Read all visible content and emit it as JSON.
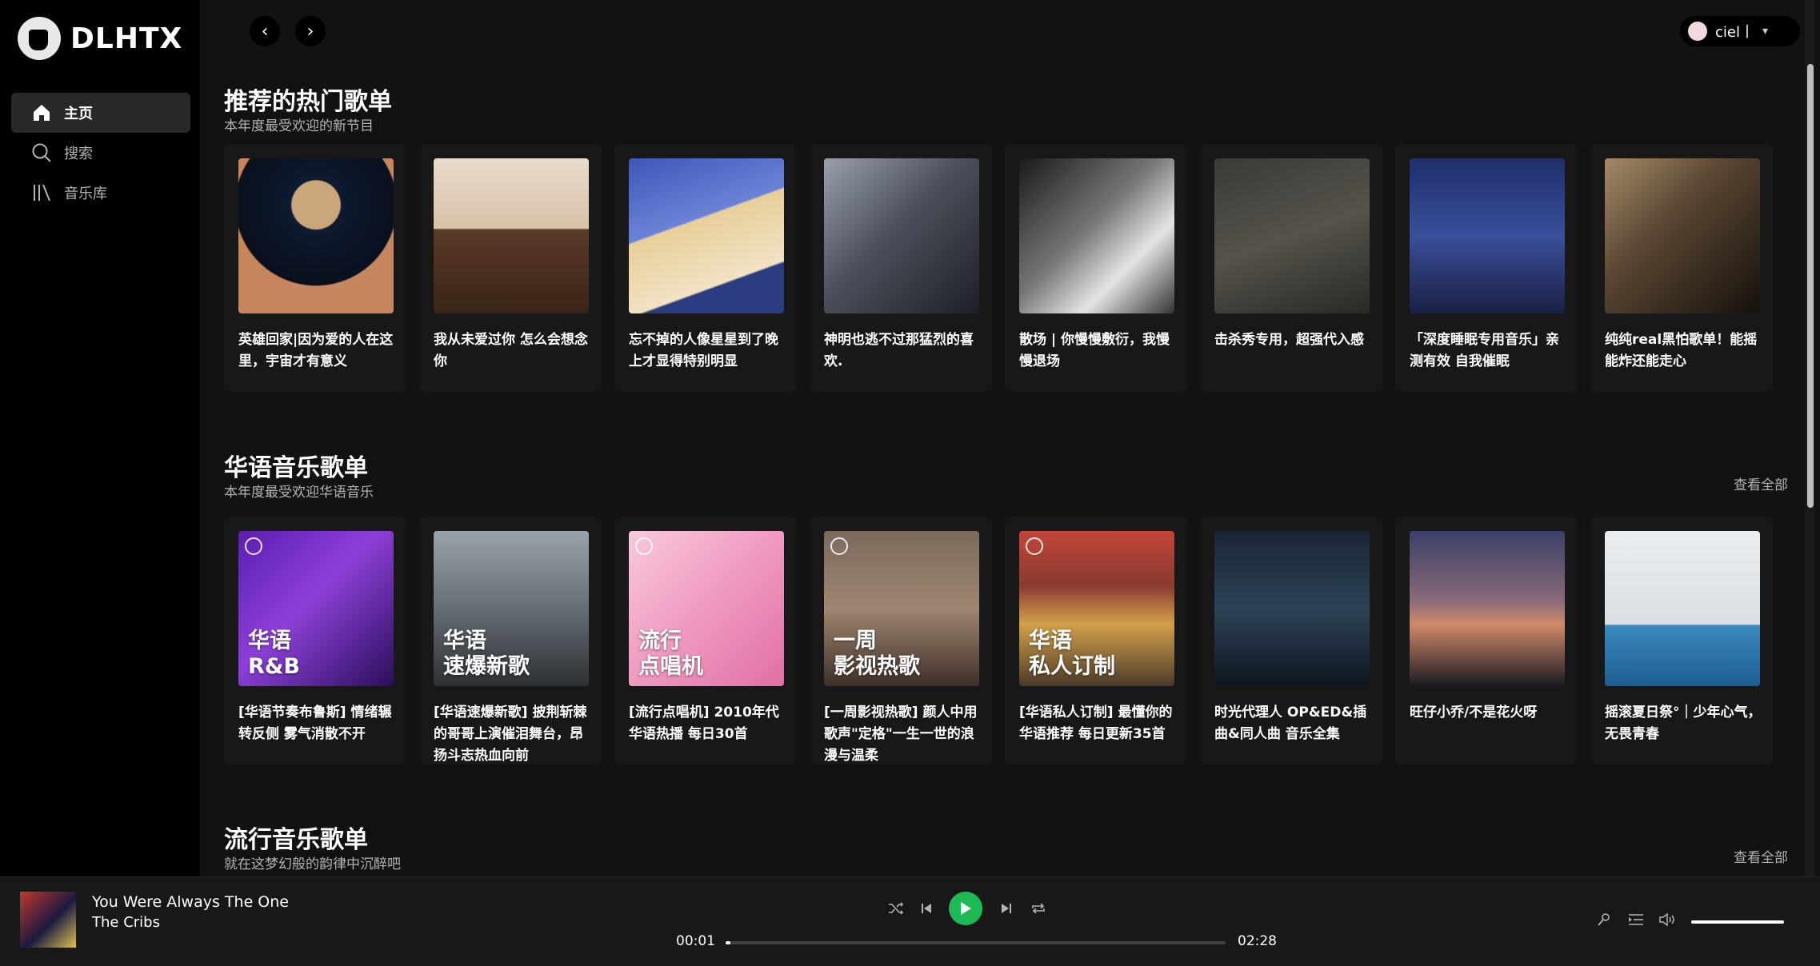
{
  "app": {
    "logo_text": "DLHTX"
  },
  "sidebar": {
    "items": [
      {
        "label": "主页",
        "icon": "home-icon",
        "active": true
      },
      {
        "label": "搜索",
        "icon": "search-icon",
        "active": false
      },
      {
        "label": "音乐库",
        "icon": "library-icon",
        "active": false
      }
    ]
  },
  "topbar": {
    "user_name": "ciel丨"
  },
  "sections": [
    {
      "title": "推荐的热门歌单",
      "subtitle": "本年度最受欢迎的新节目",
      "see_all": "",
      "cards": [
        {
          "title": "英雄回家|因为爱的人在这里，宇宙才有意义"
        },
        {
          "title": "我从未爱过你 怎么会想念你"
        },
        {
          "title": "忘不掉的人像星星到了晚上才显得特别明显"
        },
        {
          "title": "神明也逃不过那猛烈的喜欢."
        },
        {
          "title": "散场 | 你慢慢敷衍，我慢慢退场"
        },
        {
          "title": "击杀秀专用，超强代入感"
        },
        {
          "title": "「深度睡眠专用音乐」亲测有效 自我催眠"
        },
        {
          "title": "纯纯real黑怕歌单！能摇能炸还能走心"
        }
      ]
    },
    {
      "title": "华语音乐歌单",
      "subtitle": "本年度最受欢迎华语音乐",
      "see_all": "查看全部",
      "cards": [
        {
          "title": "[华语节奏布鲁斯] 情绪辗转反侧 雾气消散不开",
          "overlay": [
            "华语",
            "R&B"
          ]
        },
        {
          "title": "[华语速爆新歌] 披荆斩棘的哥哥上演催泪舞台，昂扬斗志热血向前",
          "overlay": [
            "华语",
            "速爆新歌"
          ]
        },
        {
          "title": "[流行点唱机] 2010年代华语热播 每日30首",
          "overlay": [
            "流行",
            "点唱机"
          ]
        },
        {
          "title": "[一周影视热歌] 颜人中用歌声\"定格\"一生一世的浪漫与温柔",
          "overlay": [
            "一周",
            "影视热歌"
          ]
        },
        {
          "title": "[华语私人订制] 最懂你的华语推荐 每日更新35首",
          "overlay": [
            "华语",
            "私人订制"
          ]
        },
        {
          "title": "时光代理人 OP&ED&插曲&同人曲 音乐全集"
        },
        {
          "title": "旺仔小乔/不是花火呀"
        },
        {
          "title": "摇滚夏日祭°｜少年心气，无畏青春"
        }
      ]
    },
    {
      "title": "流行音乐歌单",
      "subtitle": "就在这梦幻般的韵律中沉醉吧",
      "see_all": "查看全部"
    }
  ],
  "player": {
    "song": "You Were Always The One",
    "artist": "The Cribs",
    "current_time": "00:01",
    "total_time": "02:28",
    "progress": 0.01,
    "volume": 1.0
  },
  "colors": {
    "accent": "#1db954",
    "background": "#121212",
    "sidebar": "#000000",
    "card": "#181818"
  }
}
